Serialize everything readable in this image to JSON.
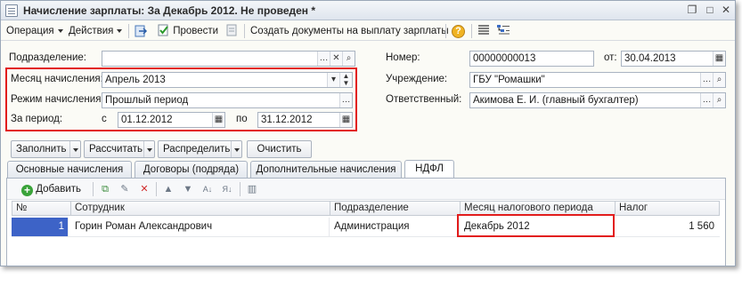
{
  "window": {
    "title": "Начисление зарплаты: За Декабрь 2012. Не проведен *",
    "buttons": {
      "restore": "❐",
      "maximize": "□",
      "close": "✕"
    }
  },
  "toolbar": {
    "operation_label": "Операция",
    "actions_label": "Действия",
    "post_label": "Провести",
    "create_docs_label": "Создать документы на выплату зарплаты",
    "help_label": "?"
  },
  "form": {
    "department_label": "Подразделение:",
    "department_value": "",
    "month_label": "Месяц начисления:",
    "month_value": "Апрель 2013",
    "mode_label": "Режим начисления:",
    "mode_value": "Прошлый период",
    "period_label": "За период:",
    "from_label": "с",
    "from_value": "01.12.2012",
    "to_label": "по",
    "to_value": "31.12.2012",
    "number_label": "Номер:",
    "number_value": "00000000013",
    "date_label": "от:",
    "date_value": "30.04.2013",
    "org_label": "Учреждение:",
    "org_value": "ГБУ \"Ромашки\"",
    "resp_label": "Ответственный:",
    "resp_value": "Акимова Е. И. (главный бухгалтер)"
  },
  "commands": {
    "fill": "Заполнить",
    "calculate": "Рассчитать",
    "distribute": "Распределить",
    "clear": "Очистить"
  },
  "tabs": [
    {
      "label": "Основные начисления"
    },
    {
      "label": "Договоры (подряда)"
    },
    {
      "label": "Дополнительные начисления"
    },
    {
      "label": "НДФЛ"
    }
  ],
  "table_toolbar": {
    "add_label": "Добавить"
  },
  "table": {
    "columns": [
      "№",
      "Сотрудник",
      "Подразделение",
      "Месяц налогового периода",
      "Налог"
    ],
    "rows": [
      {
        "num": "1",
        "employee": "Горин Роман Александрович",
        "department": "Администрация",
        "month": "Декабрь 2012",
        "tax": "1 560"
      }
    ]
  },
  "colors": {
    "highlight": "#e21c1c",
    "selected_cell": "#3d63c7"
  }
}
